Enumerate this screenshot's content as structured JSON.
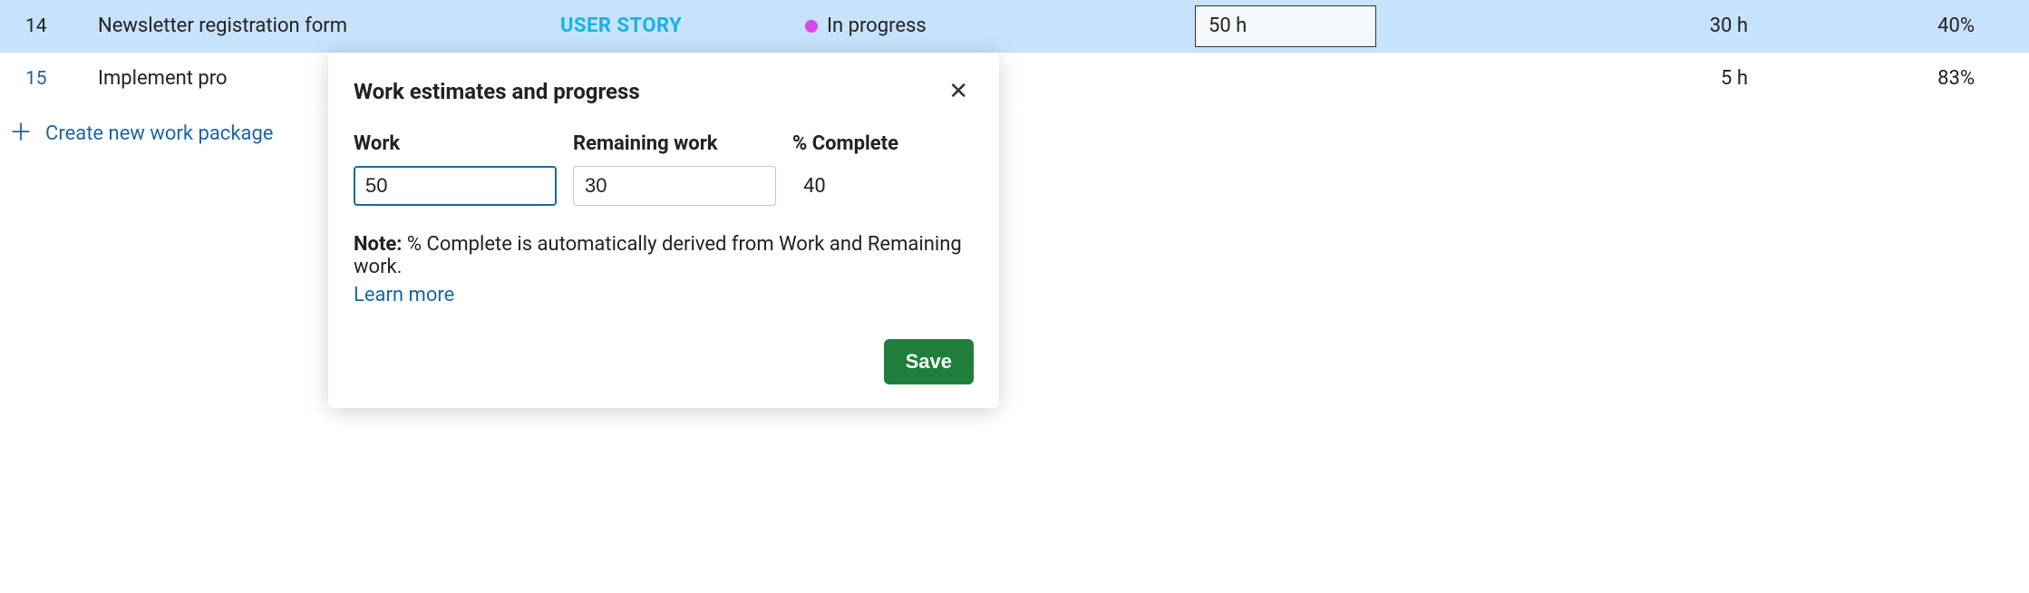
{
  "rows": [
    {
      "id": "14",
      "subject": "Newsletter registration form",
      "type": "USER STORY",
      "status": "In progress",
      "work": "50 h",
      "remaining": "30 h",
      "complete": "40%"
    },
    {
      "id": "15",
      "subject": "Implement pro",
      "type": "",
      "status": "",
      "work": "",
      "remaining": "5 h",
      "complete": "83%"
    }
  ],
  "create_link": "Create new work package",
  "modal": {
    "title": "Work estimates and progress",
    "fields": {
      "work_label": "Work",
      "work_value": "50",
      "remaining_label": "Remaining work",
      "remaining_value": "30",
      "complete_label": "% Complete",
      "complete_value": "40"
    },
    "note_prefix": "Note:",
    "note_text": " % Complete is automatically derived from Work and Remaining work.",
    "learn_more": "Learn more",
    "save": "Save"
  }
}
